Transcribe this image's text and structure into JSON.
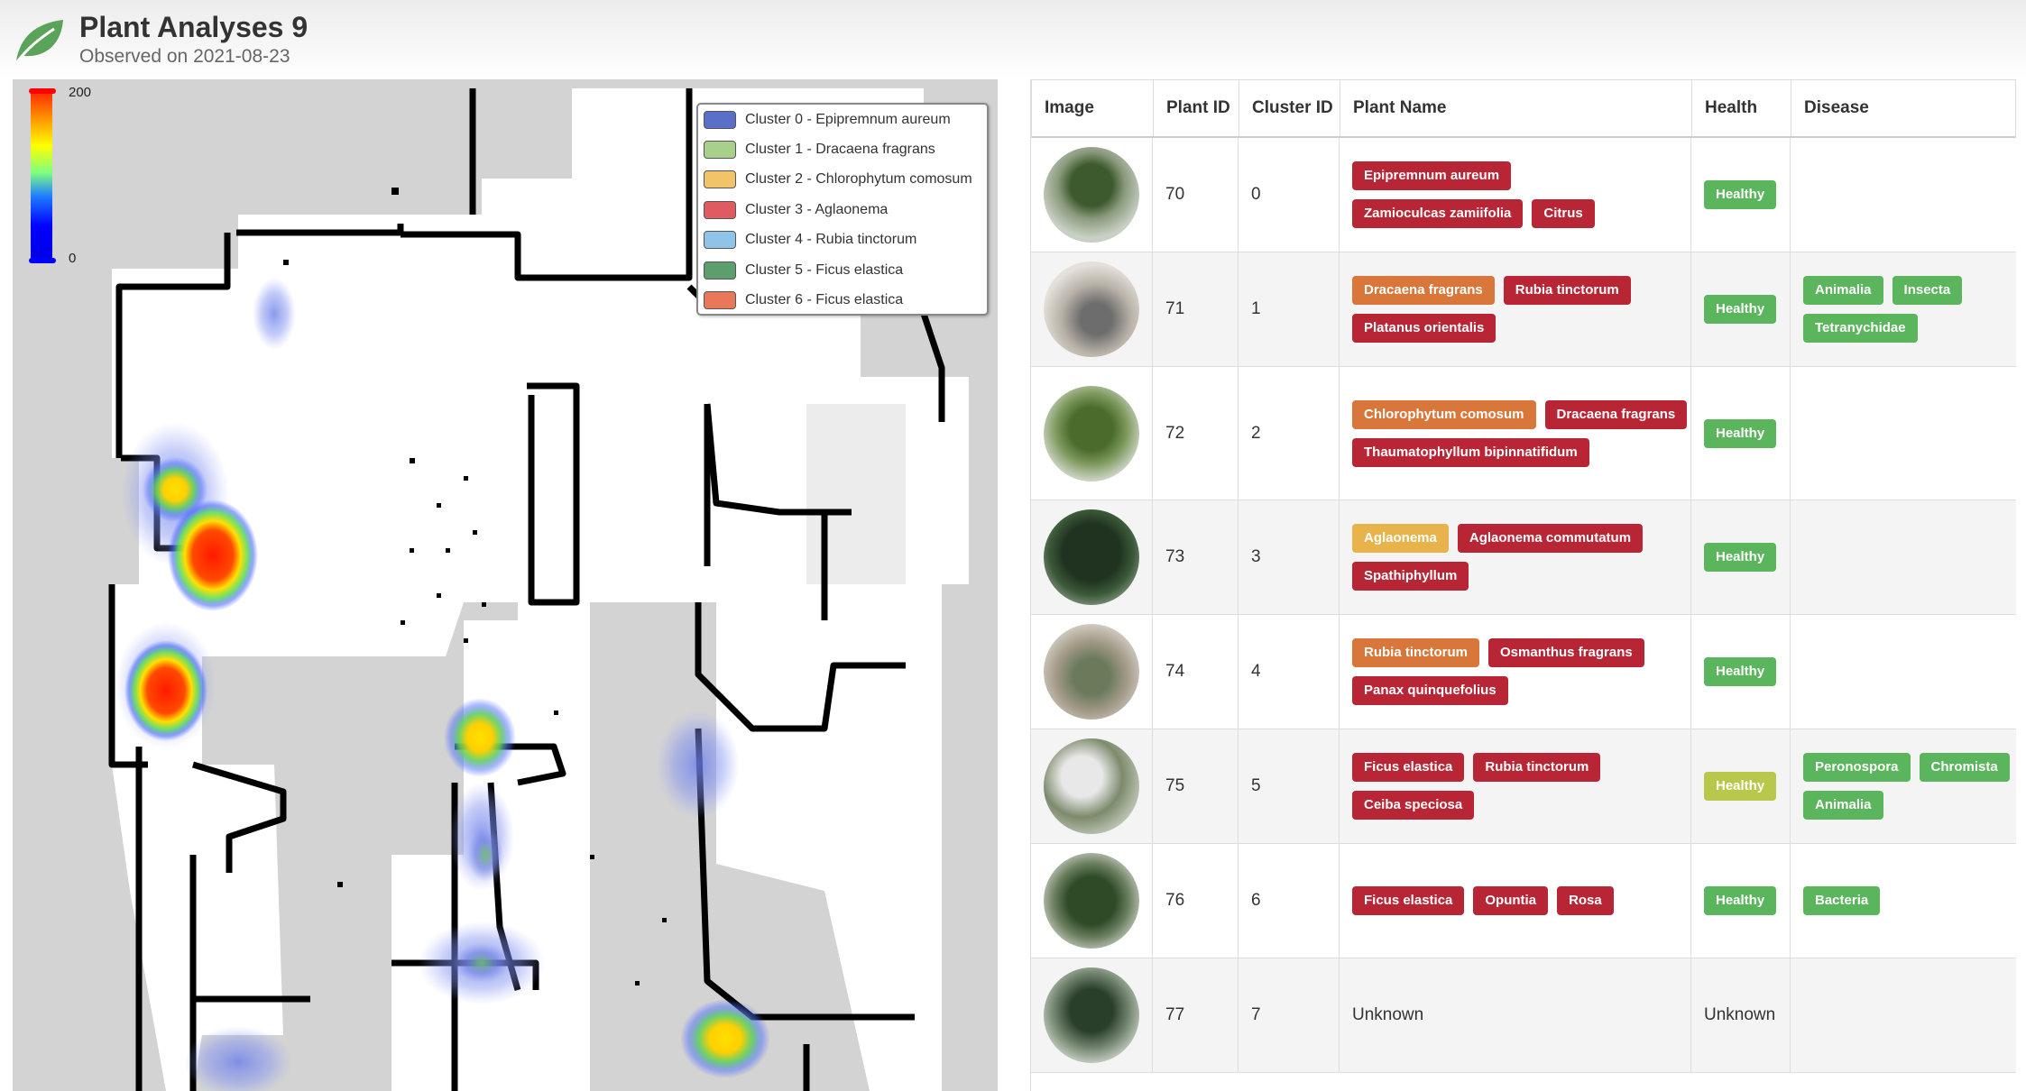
{
  "header": {
    "title": "Plant Analyses 9",
    "subtitle": "Observed on 2021-08-23"
  },
  "map": {
    "colorbar": {
      "max_label": "200",
      "min_label": "0"
    },
    "legend": [
      {
        "label": "Cluster 0 - Epipremnum aureum",
        "color": "#5a6fc8"
      },
      {
        "label": "Cluster 1 - Dracaena fragrans",
        "color": "#a8d08a"
      },
      {
        "label": "Cluster 2 - Chlorophytum comosum",
        "color": "#f2c46a"
      },
      {
        "label": "Cluster 3 - Aglaonema",
        "color": "#e05a62"
      },
      {
        "label": "Cluster 4 - Rubia tinctorum",
        "color": "#8fc3e8"
      },
      {
        "label": "Cluster 5 - Ficus elastica",
        "color": "#5c9e6e"
      },
      {
        "label": "Cluster 6 - Ficus elastica",
        "color": "#e8785a"
      }
    ]
  },
  "table": {
    "headers": {
      "image": "Image",
      "plant_id": "Plant ID",
      "cluster_id": "Cluster ID",
      "plant_name": "Plant Name",
      "health": "Health",
      "disease": "Disease"
    },
    "rows": [
      {
        "plant_id": "70",
        "cluster_id": "0",
        "names": [
          {
            "text": "Epipremnum aureum",
            "color": "red"
          },
          {
            "text": "Zamioculcas zamiifolia",
            "color": "red"
          },
          {
            "text": "Citrus",
            "color": "red"
          }
        ],
        "health": {
          "text": "Healthy",
          "color": "green"
        },
        "disease": []
      },
      {
        "plant_id": "71",
        "cluster_id": "1",
        "names": [
          {
            "text": "Dracaena fragrans",
            "color": "orange"
          },
          {
            "text": "Rubia tinctorum",
            "color": "red"
          },
          {
            "text": "Platanus orientalis",
            "color": "red"
          }
        ],
        "health": {
          "text": "Healthy",
          "color": "green"
        },
        "disease": [
          {
            "text": "Animalia",
            "color": "green"
          },
          {
            "text": "Insecta",
            "color": "green"
          },
          {
            "text": "Tetranychidae",
            "color": "green"
          }
        ]
      },
      {
        "plant_id": "72",
        "cluster_id": "2",
        "names": [
          {
            "text": "Chlorophytum comosum",
            "color": "orange"
          },
          {
            "text": "Dracaena fragrans",
            "color": "red"
          },
          {
            "text": "Thaumatophyllum bipinnatifidum",
            "color": "red"
          }
        ],
        "health": {
          "text": "Healthy",
          "color": "green"
        },
        "disease": []
      },
      {
        "plant_id": "73",
        "cluster_id": "3",
        "names": [
          {
            "text": "Aglaonema",
            "color": "yellow"
          },
          {
            "text": "Aglaonema commutatum",
            "color": "red"
          },
          {
            "text": "Spathiphyllum",
            "color": "red"
          }
        ],
        "health": {
          "text": "Healthy",
          "color": "green"
        },
        "disease": []
      },
      {
        "plant_id": "74",
        "cluster_id": "4",
        "names": [
          {
            "text": "Rubia tinctorum",
            "color": "orange"
          },
          {
            "text": "Osmanthus fragrans",
            "color": "red"
          },
          {
            "text": "Panax quinquefolius",
            "color": "red"
          }
        ],
        "health": {
          "text": "Healthy",
          "color": "green"
        },
        "disease": []
      },
      {
        "plant_id": "75",
        "cluster_id": "5",
        "names": [
          {
            "text": "Ficus elastica",
            "color": "red"
          },
          {
            "text": "Rubia tinctorum",
            "color": "red"
          },
          {
            "text": "Ceiba speciosa",
            "color": "red"
          }
        ],
        "health": {
          "text": "Healthy",
          "color": "lime"
        },
        "disease": [
          {
            "text": "Peronospora",
            "color": "green"
          },
          {
            "text": "Chromista",
            "color": "green"
          },
          {
            "text": "Animalia",
            "color": "green"
          }
        ]
      },
      {
        "plant_id": "76",
        "cluster_id": "6",
        "names": [
          {
            "text": "Ficus elastica",
            "color": "red"
          },
          {
            "text": "Opuntia",
            "color": "red"
          },
          {
            "text": "Rosa",
            "color": "red"
          }
        ],
        "health": {
          "text": "Healthy",
          "color": "green"
        },
        "disease": [
          {
            "text": "Bacteria",
            "color": "green"
          }
        ]
      },
      {
        "plant_id": "77",
        "cluster_id": "7",
        "names": [],
        "name_text": "Unknown",
        "health": {
          "text": "Unknown",
          "color": ""
        },
        "disease": []
      }
    ]
  }
}
